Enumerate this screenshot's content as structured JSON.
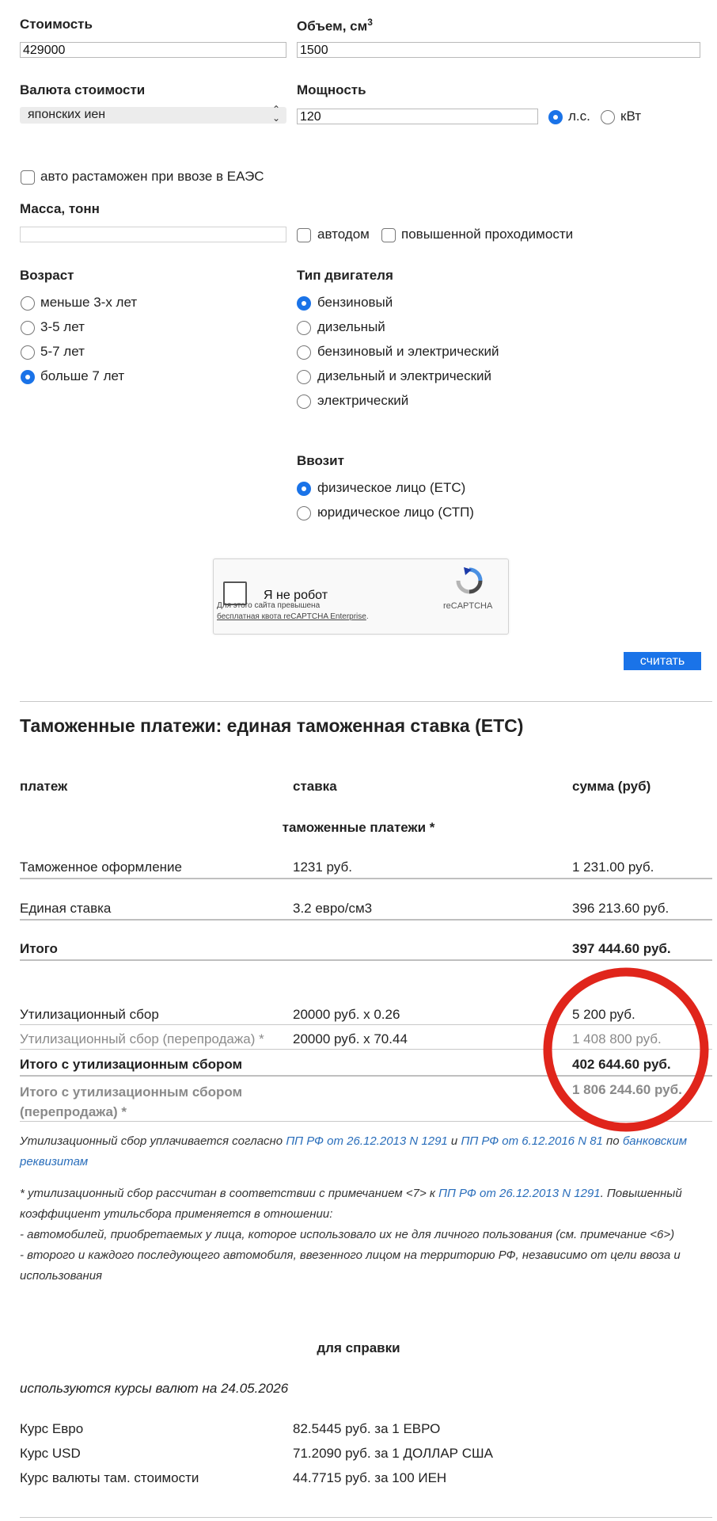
{
  "form": {
    "cost_label": "Стоимость",
    "cost_value": "429000",
    "volume_label": "Объем, см",
    "volume_sup": "3",
    "volume_value": "1500",
    "currency_label": "Валюта стоимости",
    "currency_value": "японских иен",
    "power_label": "Мощность",
    "power_value": "120",
    "power_unit_hp": "л.с.",
    "power_unit_kw": "кВт",
    "eaes_label": "авто растаможен при ввозе в ЕАЭС",
    "mass_label": "Масса, тонн",
    "mass_value": "",
    "motorhome_label": "автодом",
    "offroad_label": "повышенной проходимости",
    "age_label": "Возраст",
    "age_options": [
      "меньше 3-х лет",
      "3-5 лет",
      "5-7 лет",
      "больше 7 лет"
    ],
    "age_selected": "больше 7 лет",
    "engine_label": "Тип двигателя",
    "engine_options": [
      "бензиновый",
      "дизельный",
      "бензиновый и электрический",
      "дизельный и электрический",
      "электрический"
    ],
    "engine_selected": "бензиновый",
    "importer_label": "Ввозит",
    "importer_options": [
      "физическое лицо (ЕТС)",
      "юридическое лицо (СТП)"
    ],
    "importer_selected": "физическое лицо (ЕТС)",
    "submit_label": "считать"
  },
  "captcha": {
    "label": "Я не робот",
    "brand": "reCAPTCHA",
    "warning_prefix": "Для этого сайта превышена",
    "warning_link": "бесплатная квота reCAPTCHA Enterprise",
    "warning_suffix": "."
  },
  "results": {
    "title": "Таможенные платежи: единая таможенная ставка (ЕТС)",
    "col_payment": "платеж",
    "col_rate": "ставка",
    "col_sum": "сумма (руб)",
    "section_label": "таможенные платежи *",
    "rows": [
      {
        "name": "Таможенное оформление",
        "rate": "1231 руб.",
        "sum": "1 231.00 руб."
      },
      {
        "name": "Единая ставка",
        "rate": "3.2 евро/см3",
        "sum": "396 213.60 руб."
      }
    ],
    "total_label": "Итого",
    "total_sum": "397 444.60 руб.",
    "util_label": "Утилизационный сбор",
    "util_rate": "20000 руб. x 0.26",
    "util_sum": "5 200 руб.",
    "util_resale_label": "Утилизационный сбор (перепродажа) *",
    "util_resale_rate": "20000 руб. x 70.44",
    "util_resale_sum": "1 408 800 руб.",
    "total_util_label": "Итого с утилизационным сбором",
    "total_util_sum": "402 644.60 руб.",
    "total_util_resale_label_1": "Итого с утилизационным сбором",
    "total_util_resale_label_2": "(перепродажа) *",
    "total_util_resale_sum": "1 806 244.60 руб."
  },
  "notes": {
    "n1_a": "Утилизационный сбор уплачивается согласно ",
    "n1_link1": "ПП РФ от 26.12.2013 N 1291",
    "n1_b": " и ",
    "n1_link2": "ПП РФ от 6.12.2016 N 81",
    "n1_c": " по ",
    "n1_link3a": "банковским",
    "n1_link3b": "реквизитам",
    "n2_a": "* утилизационный сбор рассчитан в соответствии с примечанием <7> к ",
    "n2_link": "ПП РФ от 26.12.2013 N 1291",
    "n2_b": ". Повышенный",
    "n2_line2": "коэффициент утильсбора применяется в отношении:",
    "n2_line3": "- автомобилей, приобретаемых у лица, которое использовало их не для личного пользования (см. примечание <6>)",
    "n2_line4": "- второго и каждого последующего автомобиля, ввезенного лицом на территорию РФ, независимо от цели ввоза и",
    "n2_line5": "использования"
  },
  "reference": {
    "title": "для справки",
    "rates_date": "используются курсы валют на 24.05.2026",
    "rates": [
      {
        "name": "Курс Евро",
        "value": "82.5445 руб. за 1 ЕВРО"
      },
      {
        "name": "Курс USD",
        "value": "71.2090 руб. за 1 ДОЛЛАР США"
      },
      {
        "name": "Курс валюты там. стоимости",
        "value": "44.7715 руб. за 100 ИЕН"
      }
    ]
  },
  "colors": {
    "accent": "#1a73e8",
    "link": "#2a6ebb",
    "highlight_circle": "#e0251b"
  }
}
